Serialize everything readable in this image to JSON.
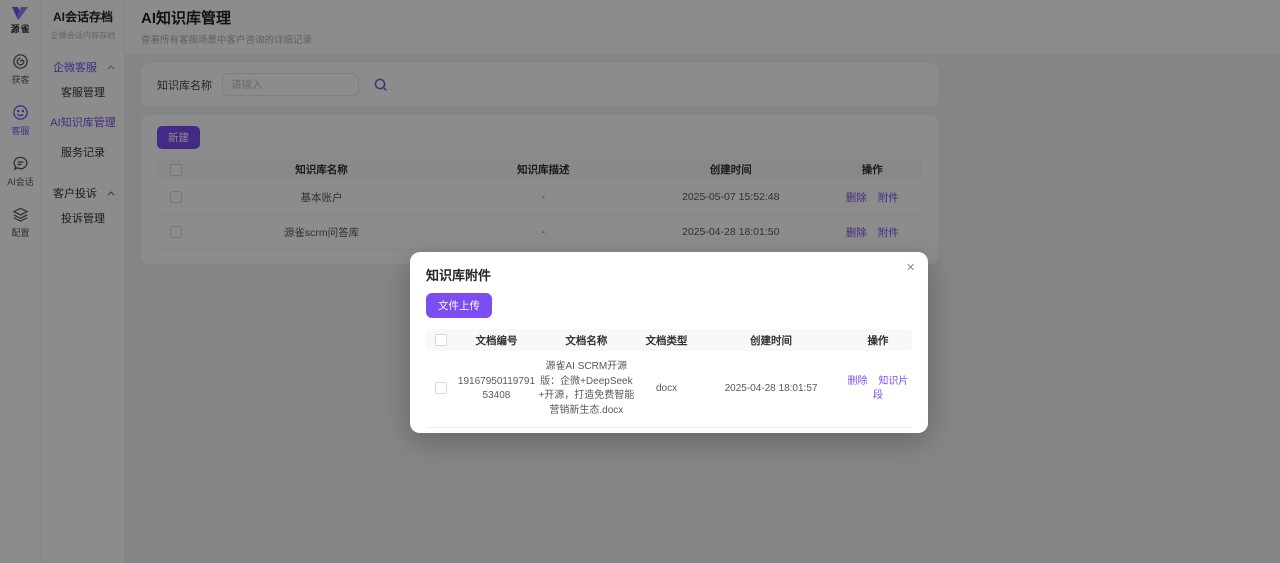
{
  "brand": {
    "name": "源雀"
  },
  "rail": {
    "items": [
      {
        "label": "获客",
        "icon": "spiral-icon"
      },
      {
        "label": "客服",
        "icon": "smiley-icon"
      },
      {
        "label": "AI会话",
        "icon": "chat-bubble-icon"
      },
      {
        "label": "配置",
        "icon": "layers-icon"
      }
    ]
  },
  "sidebar": {
    "title": "AI会话存档",
    "subtitle": "企微会话内容存档",
    "groups": [
      {
        "label": "企微客服",
        "items": [
          {
            "label": "客服管理"
          },
          {
            "label": "AI知识库管理"
          },
          {
            "label": "服务记录"
          }
        ]
      },
      {
        "label": "客户投诉",
        "items": [
          {
            "label": "投诉管理"
          }
        ]
      }
    ]
  },
  "page": {
    "title": "AI知识库管理",
    "subtitle": "查看所有客服场景中客户咨询的详细记录"
  },
  "search": {
    "label": "知识库名称",
    "placeholder": "请输入",
    "icon": "search-icon"
  },
  "toolbar": {
    "create_label": "新建"
  },
  "kb_table": {
    "headers": [
      "知识库名称",
      "知识库描述",
      "创建时间",
      "操作"
    ],
    "rows": [
      {
        "name": "基本账户",
        "desc": "-",
        "created": "2025-05-07 15:52:48",
        "actions": [
          "删除",
          "附件"
        ]
      },
      {
        "name": "源雀scrm问答库",
        "desc": "-",
        "created": "2025-04-28 18:01:50",
        "actions": [
          "删除",
          "附件"
        ]
      }
    ]
  },
  "modal": {
    "title": "知识库附件",
    "close_glyph": "×",
    "upload_label": "文件上传",
    "table": {
      "headers": [
        "文档编号",
        "文档名称",
        "文档类型",
        "创建时间",
        "操作"
      ],
      "rows": [
        {
          "id": "1916795011979153408",
          "name": "源雀AI SCRM开源版：企微+DeepSeek+开源，打造免费智能营销新生态.docx",
          "type": "docx",
          "created": "2025-04-28 18:01:57",
          "actions": [
            "删除",
            "知识片段"
          ]
        }
      ]
    }
  },
  "colors": {
    "accent": "#7c4df0",
    "page_bg": "#f0f2f5",
    "overlay": "rgba(0,0,0,0.45)"
  }
}
